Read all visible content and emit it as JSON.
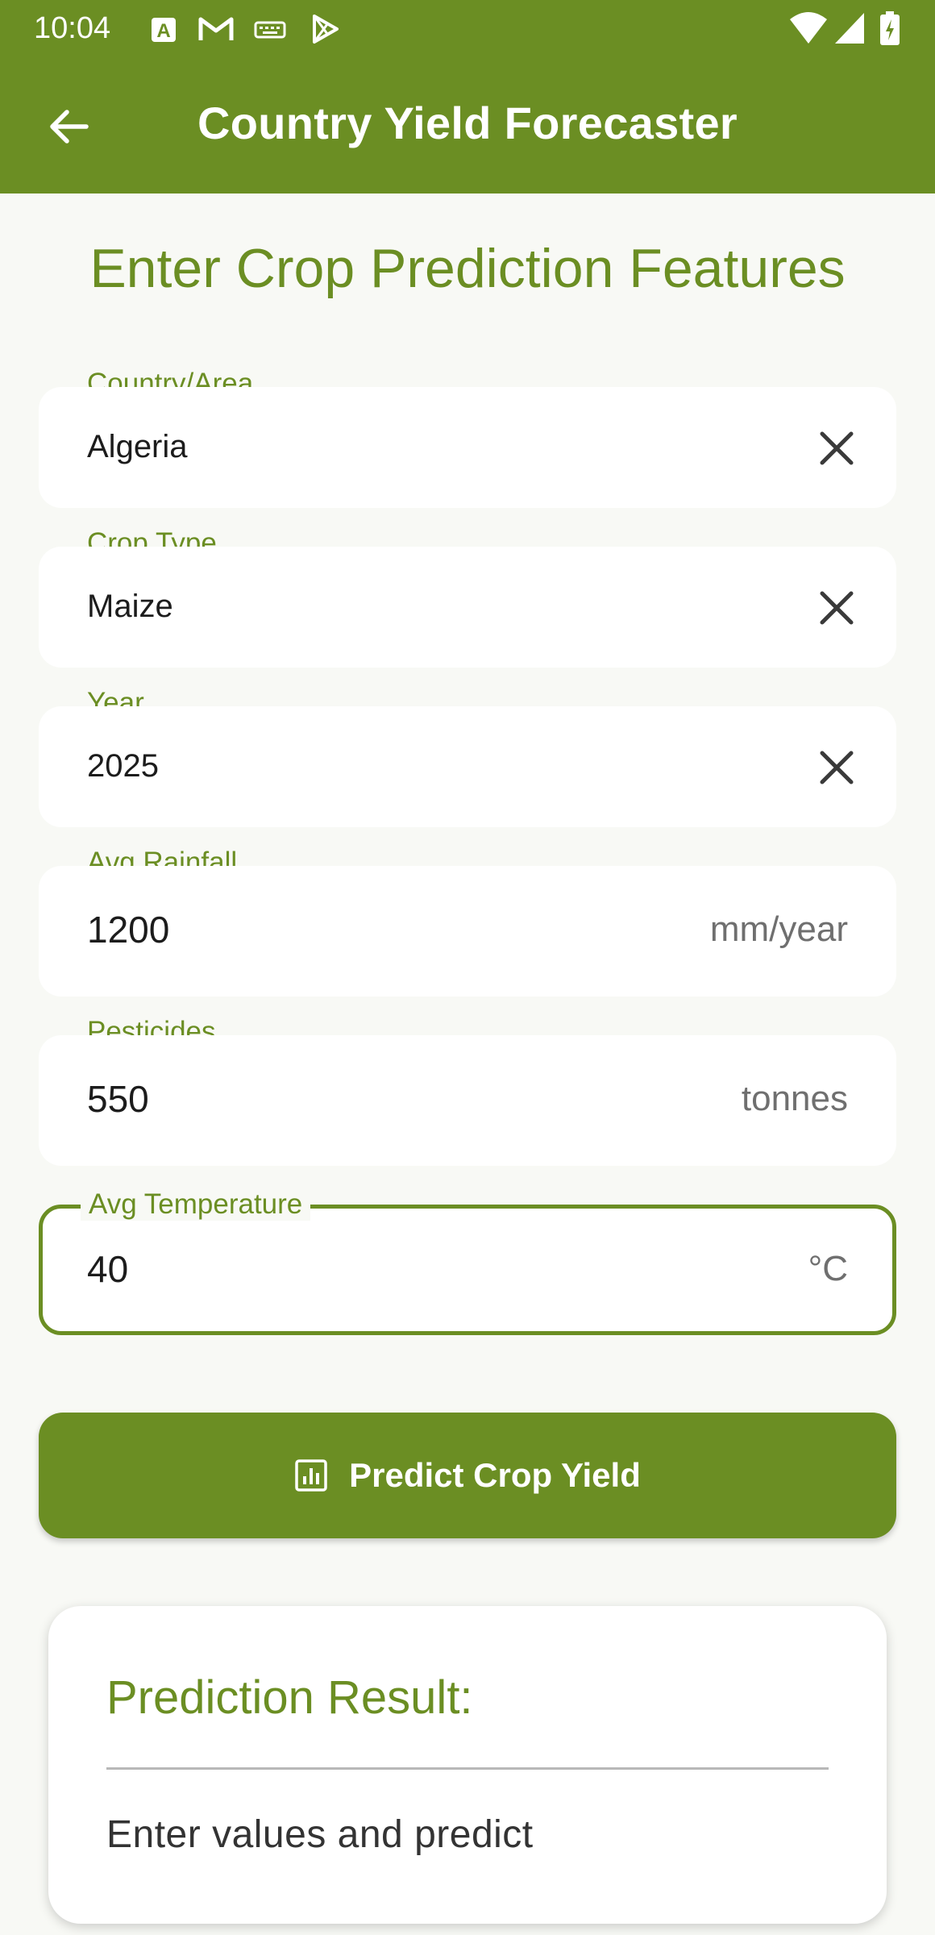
{
  "status_bar": {
    "time": "10:04",
    "notification_icons": [
      "a-text-icon",
      "gmail-icon",
      "keyboard-icon",
      "play-store-icon"
    ],
    "system_icons": [
      "wifi-icon",
      "signal-icon",
      "battery-charging-icon"
    ]
  },
  "app_bar": {
    "title": "Country Yield Forecaster",
    "back_icon": "arrow-back-icon"
  },
  "heading": "Enter Crop Prediction Features",
  "fields": {
    "country": {
      "label": "Country/Area",
      "value": "Algeria"
    },
    "crop": {
      "label": "Crop Type",
      "value": "Maize"
    },
    "year": {
      "label": "Year",
      "value": "2025"
    },
    "rainfall": {
      "label": "Avg Rainfall",
      "value": "1200",
      "suffix": "mm/year"
    },
    "pesticides": {
      "label": "Pesticides",
      "value": "550",
      "suffix": "tonnes"
    },
    "temperature": {
      "label": "Avg Temperature",
      "value": "40",
      "suffix": "°C"
    }
  },
  "predict_button": {
    "label": "Predict Crop Yield",
    "icon": "bar-chart-icon"
  },
  "result": {
    "title": "Prediction Result:",
    "text": "Enter values and predict"
  },
  "colors": {
    "primary": "#6b8e23",
    "background": "#f8f9f5",
    "field_background": "#ffffff"
  }
}
